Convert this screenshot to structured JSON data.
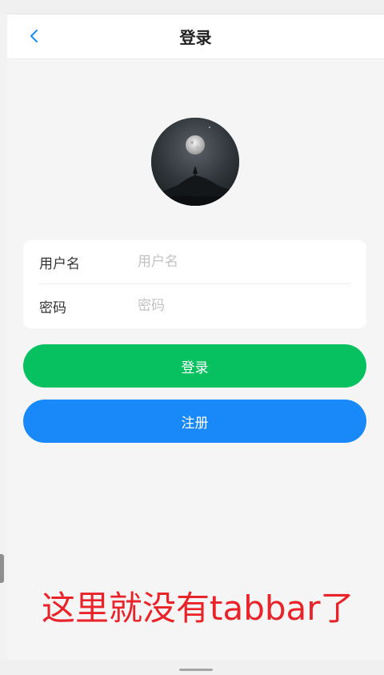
{
  "navbar": {
    "title": "登录",
    "back_icon": "chevron-left-icon",
    "back_color": "#1989fa"
  },
  "avatar": {
    "image": "moon-night-landscape"
  },
  "form": {
    "username_label": "用户名",
    "username_placeholder": "用户名",
    "password_label": "密码",
    "password_placeholder": "密码"
  },
  "buttons": {
    "login_label": "登录",
    "login_color": "#07c160",
    "register_label": "注册",
    "register_color": "#1989fa"
  },
  "annotation": {
    "text": "这里就没有tabbar了",
    "color": "#e8242a"
  }
}
